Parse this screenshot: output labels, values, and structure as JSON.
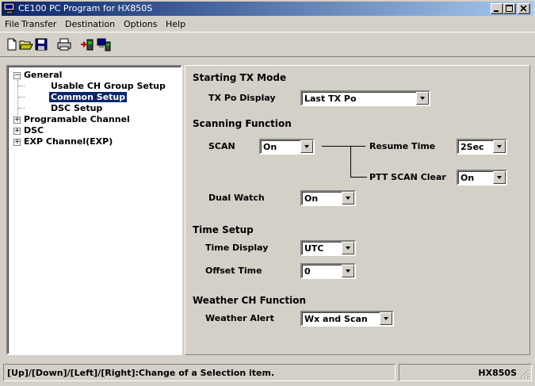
{
  "window": {
    "title": "CE100  PC Program for HX850S"
  },
  "menu": [
    {
      "label": "File"
    },
    {
      "label": "Transfer"
    },
    {
      "label": "Destination"
    },
    {
      "label": "Options"
    },
    {
      "label": "Help"
    }
  ],
  "toolbar": {
    "icons": [
      "new-document-icon",
      "open-folder-icon",
      "save-disk-icon",
      "print-icon",
      "read-from-radio-icon",
      "write-to-radio-icon"
    ]
  },
  "tree": {
    "general": "General",
    "usable_ch": "Usable CH Group Setup",
    "common": "Common Setup",
    "dsc_setup": "DSC Setup",
    "programable": "Programable Channel",
    "dsc": "DSC",
    "exp": "EXP Channel(EXP)"
  },
  "panel": {
    "starting_tx_mode": "Starting TX Mode",
    "tx_po_display_label": "TX Po Display",
    "tx_po_display_value": "Last TX Po",
    "scanning_function": "Scanning Function",
    "scan_label": "SCAN",
    "scan_value": "On",
    "resume_time_label": "Resume Time",
    "resume_time_value": "2Sec",
    "ptt_scan_clear_label": "PTT SCAN Clear",
    "ptt_scan_clear_value": "On",
    "dual_watch_label": "Dual Watch",
    "dual_watch_value": "On",
    "time_setup": "Time Setup",
    "time_display_label": "Time Display",
    "time_display_value": "UTC",
    "offset_time_label": "Offset Time",
    "offset_time_value": "0",
    "weather_ch_function": "Weather CH Function",
    "weather_alert_label": "Weather Alert",
    "weather_alert_value": "Wx and Scan"
  },
  "status": {
    "hint": "[Up]/[Down]/[Left]/[Right]:Change of a Selection item.",
    "model": "HX850S"
  },
  "colors": {
    "title_bar_start": "#0a246a",
    "title_bar_end": "#a6caf0",
    "selection": "#0a246a",
    "face": "#d4d0c8"
  }
}
